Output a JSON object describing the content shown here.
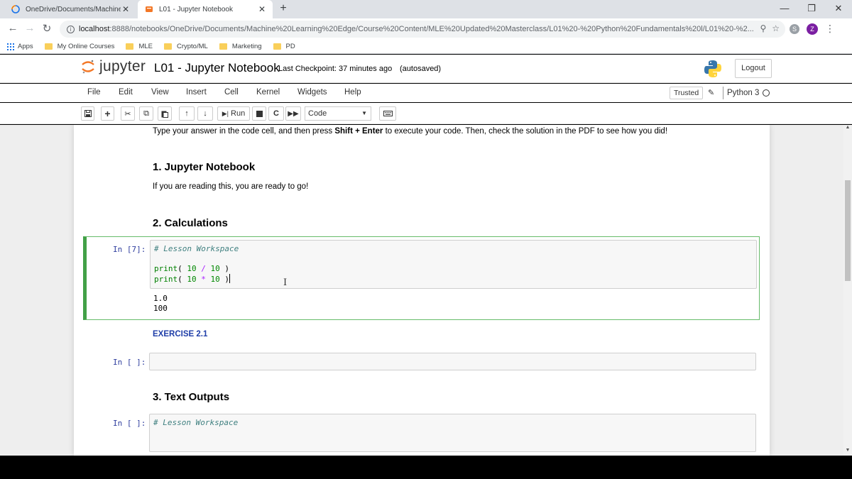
{
  "browser": {
    "tabs": [
      {
        "title": "OneDrive/Documents/Machine L",
        "close": "✕"
      },
      {
        "title": "L01 - Jupyter Notebook",
        "close": "✕"
      }
    ],
    "new_tab": "+",
    "window_controls": {
      "minimize": "—",
      "restore": "❐",
      "close": "✕"
    },
    "url_host": "localhost",
    "url_path": ":8888/notebooks/OneDrive/Documents/Machine%20Learning%20Edge/Course%20Content/MLE%20Updated%20Masterclass/L01%20-%20Python%20Fundamentals%20l/L01%20-%2...",
    "avatar_letter": "Z",
    "bookmarks": [
      {
        "label": "Apps"
      },
      {
        "label": "My Online Courses"
      },
      {
        "label": "MLE"
      },
      {
        "label": "Crypto/ML"
      },
      {
        "label": "Marketing"
      },
      {
        "label": "PD"
      }
    ]
  },
  "jupyter": {
    "logo_text": "jupyter",
    "notebook_title": "L01 - Jupyter Notebook",
    "checkpoint": "Last Checkpoint: 37 minutes ago",
    "autosave": "(autosaved)",
    "logout": "Logout",
    "menus": [
      "File",
      "Edit",
      "View",
      "Insert",
      "Cell",
      "Kernel",
      "Widgets",
      "Help"
    ],
    "trusted": "Trusted",
    "kernel": "Python 3",
    "toolbar": {
      "run": "Run",
      "cell_type": "Code"
    }
  },
  "notebook": {
    "intro_pre": "Type your answer in the code cell, and then press ",
    "intro_key": "Shift + Enter",
    "intro_post": " to execute your code. Then, check the solution in the PDF to see how you did!",
    "h1": "1. Jupyter Notebook",
    "p1": "If you are reading this, you are ready to go!",
    "h2": "2. Calculations",
    "cell1": {
      "prompt": "In [7]:",
      "comment": "# Lesson Workspace",
      "line1": [
        "print",
        "( ",
        "10",
        " / ",
        "10",
        " )"
      ],
      "line2": [
        "print",
        "( ",
        "10",
        " * ",
        "10",
        " )"
      ],
      "output": [
        "1.0",
        "100"
      ]
    },
    "exercise": "EXERCISE 2.1",
    "cell2": {
      "prompt": "In [ ]:"
    },
    "h3": "3. Text Outputs",
    "cell3": {
      "prompt": "In [ ]:",
      "comment": "# Lesson Workspace"
    }
  },
  "colors": {
    "cell_selected": "#42a047",
    "prompt": "#303f9f",
    "exercise": "#1f3ea8"
  }
}
